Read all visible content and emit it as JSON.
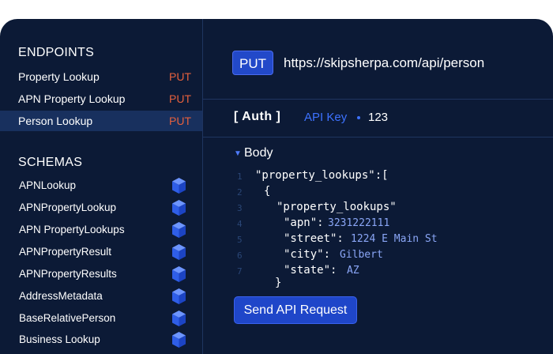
{
  "endpoints": {
    "heading": "ENDPOINTS",
    "items": [
      {
        "label": "Property Lookup",
        "method": "PUT"
      },
      {
        "label": "APN Property Lookup",
        "method": "PUT"
      },
      {
        "label": "Person Lookup",
        "method": "PUT"
      }
    ]
  },
  "schemas": {
    "heading": "SCHEMAS",
    "items": [
      {
        "label": "APNLookup"
      },
      {
        "label": "APNPropertyLookup"
      },
      {
        "label": "APN PropertyLookups"
      },
      {
        "label": "APNPropertyResult"
      },
      {
        "label": "APNPropertyResults"
      },
      {
        "label": "AddressMetadata"
      },
      {
        "label": "BaseRelativePerson"
      },
      {
        "label": "Business Lookup"
      }
    ],
    "icon": "cube-icon"
  },
  "request": {
    "method": "PUT",
    "url": "https://skipsherpa.com/api/person"
  },
  "auth": {
    "tag": "[ Auth ]",
    "key_label": "API Key",
    "value": "123"
  },
  "body": {
    "label": "Body",
    "lines": [
      {
        "num": "1",
        "key": "\"property_lookups\":[",
        "value": ""
      },
      {
        "num": "2",
        "key": "{",
        "value": ""
      },
      {
        "num": "3",
        "key": "\"property_lookups\"",
        "value": ""
      },
      {
        "num": "4",
        "key": "\"apn\":",
        "value": "3231222111"
      },
      {
        "num": "5",
        "key": "\"street\":",
        "value": "1224 E Main St"
      },
      {
        "num": "6",
        "key": "\"city\":",
        "value": "Gilbert"
      },
      {
        "num": "7",
        "key": "\"state\":",
        "value": "AZ"
      },
      {
        "num": "",
        "key": "}",
        "value": ""
      }
    ]
  },
  "send_button": {
    "label": "Send API Request"
  },
  "colors": {
    "panel_bg": "#0c1a36",
    "active_row": "#18305e",
    "method_put": "#e5603d",
    "accent_blue": "#2249c9",
    "link_blue": "#3d72ff",
    "code_value": "#8aa6f6"
  }
}
